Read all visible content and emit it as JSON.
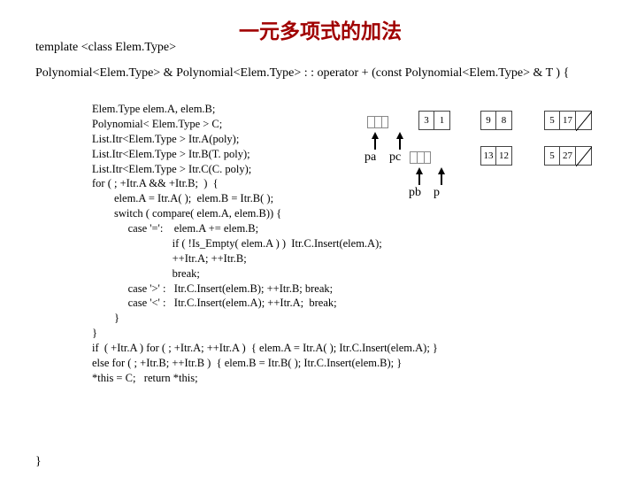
{
  "title": "一元多项式的加法",
  "template_line": "template <class Elem.Type>",
  "signature": "Polynomial<Elem.Type> & Polynomial<Elem.Type> : : operator + (const Polynomial<Elem.Type>\n                                                                                                          & T )         {",
  "code": "Elem.Type elem.A, elem.B;\nPolynomial< Elem.Type > C;\nList.Itr<Elem.Type > Itr.A(poly);\nList.Itr<Elem.Type > Itr.B(T. poly);\nList.Itr<Elem.Type > Itr.C(C. poly);\nfor ( ; +Itr.A && +Itr.B;  )  {\n        elem.A = Itr.A( );  elem.B = Itr.B( );\n        switch ( compare( elem.A, elem.B)) {\n             case '=':    elem.A += elem.B;\n                             if ( !Is_Empty( elem.A ) )  Itr.C.Insert(elem.A);\n                             ++Itr.A; ++Itr.B;\n                             break;\n             case '>' :   Itr.C.Insert(elem.B); ++Itr.B; break;\n             case '<' :   Itr.C.Insert(elem.A); ++Itr.A;  break;\n        }\n}\nif  ( +Itr.A ) for ( ; +Itr.A; ++Itr.A )  { elem.A = Itr.A( ); Itr.C.Insert(elem.A); }\nelse for ( ; +Itr.B; ++Itr.B )  { elem.B = Itr.B( ); Itr.C.Insert(elem.B); }\n*this = C;   return *this;",
  "closing": "}",
  "diagram": {
    "row1": {
      "n1": {
        "a": "3",
        "b": "1"
      },
      "n2": {
        "a": "9",
        "b": "8"
      },
      "n3": {
        "a": "5",
        "b": "17"
      }
    },
    "row2": {
      "n1": {
        "a": "13",
        "b": "12"
      },
      "n2": {
        "a": "5",
        "b": "27"
      }
    },
    "ptrs": {
      "r1a": "pa",
      "r1b": "pc",
      "r2a": "pb",
      "r2b": "p"
    }
  }
}
